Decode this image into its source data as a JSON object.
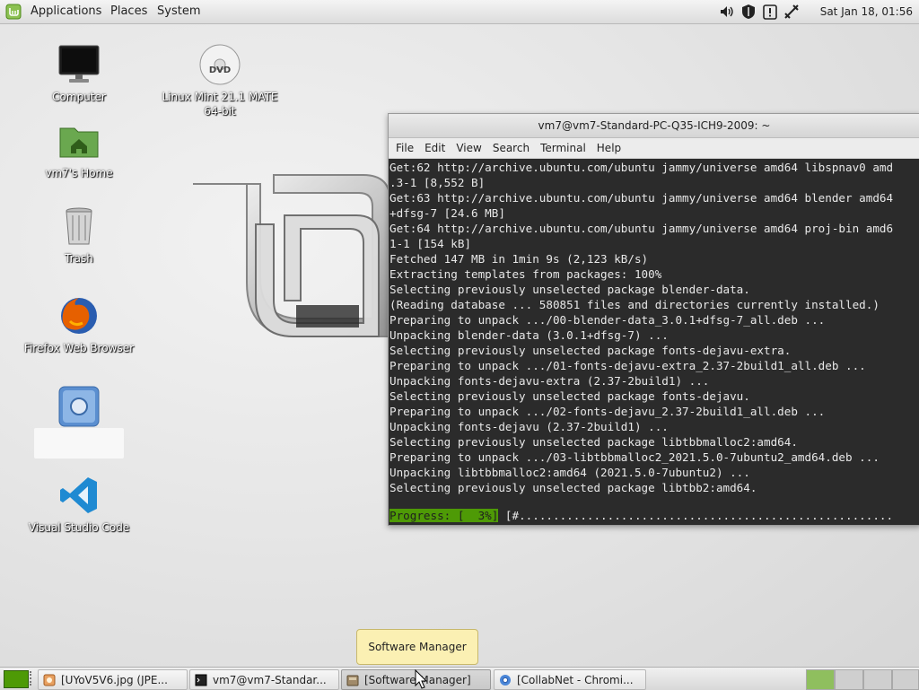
{
  "top_panel": {
    "menus": [
      "Applications",
      "Places",
      "System"
    ],
    "clock": "Sat Jan 18, 01:56",
    "tray_icons": [
      "volume-icon",
      "shield-icon",
      "update-alert-icon",
      "network-icon"
    ]
  },
  "desktop_icons": [
    {
      "label": "Computer",
      "icon": "computer-icon"
    },
    {
      "label": "Linux Mint 21.1 MATE 64-bit",
      "line1": "Linux Mint 21.1 MATE",
      "line2": "64-bit",
      "icon": "dvd-icon"
    },
    {
      "label": "vm7's Home",
      "icon": "home-folder-icon"
    },
    {
      "label": "Trash",
      "icon": "trash-icon"
    },
    {
      "label": "Firefox Web Browser",
      "icon": "firefox-icon"
    },
    {
      "label": "",
      "icon": "chrome-icon"
    },
    {
      "label": "Visual Studio Code",
      "icon": "vscode-icon"
    }
  ],
  "terminal": {
    "title": "vm7@vm7-Standard-PC-Q35-ICH9-2009: ~",
    "menu": [
      "File",
      "Edit",
      "View",
      "Search",
      "Terminal",
      "Help"
    ],
    "lines": [
      "Get:62 http://archive.ubuntu.com/ubuntu jammy/universe amd64 libspnav0 amd",
      ".3-1 [8,552 B]",
      "Get:63 http://archive.ubuntu.com/ubuntu jammy/universe amd64 blender amd64",
      "+dfsg-7 [24.6 MB]",
      "Get:64 http://archive.ubuntu.com/ubuntu jammy/universe amd64 proj-bin amd6",
      "1-1 [154 kB]",
      "Fetched 147 MB in 1min 9s (2,123 kB/s)",
      "Extracting templates from packages: 100%",
      "Selecting previously unselected package blender-data.",
      "(Reading database ... 580851 files and directories currently installed.)",
      "Preparing to unpack .../00-blender-data_3.0.1+dfsg-7_all.deb ...",
      "Unpacking blender-data (3.0.1+dfsg-7) ...",
      "Selecting previously unselected package fonts-dejavu-extra.",
      "Preparing to unpack .../01-fonts-dejavu-extra_2.37-2build1_all.deb ...",
      "Unpacking fonts-dejavu-extra (2.37-2build1) ...",
      "Selecting previously unselected package fonts-dejavu.",
      "Preparing to unpack .../02-fonts-dejavu_2.37-2build1_all.deb ...",
      "Unpacking fonts-dejavu (2.37-2build1) ...",
      "Selecting previously unselected package libtbbmalloc2:amd64.",
      "Preparing to unpack .../03-libtbbmalloc2_2021.5.0-7ubuntu2_amd64.deb ...",
      "Unpacking libtbbmalloc2:amd64 (2021.5.0-7ubuntu2) ...",
      "Selecting previously unselected package libtbb2:amd64."
    ],
    "progress_label": "Progress: [  3%]",
    "progress_bar": " [#.......................................................",
    "progress_percent": 3
  },
  "tooltip": "Software Manager",
  "taskbar": {
    "tasks": [
      {
        "label": "[UYoV5V6.jpg (JPE...",
        "icon": "image-viewer-icon"
      },
      {
        "label": "vm7@vm7-Standar...",
        "icon": "terminal-icon"
      },
      {
        "label": "[Software Manager]",
        "icon": "software-manager-icon"
      },
      {
        "label": "[CollabNet - Chromi...",
        "icon": "chromium-icon"
      }
    ],
    "workspaces": 4,
    "active_workspace": 1
  },
  "colors": {
    "mint_green": "#4e9a06",
    "terminal_bg": "#2b2b2b",
    "tooltip_bg": "#fbf0b3"
  }
}
